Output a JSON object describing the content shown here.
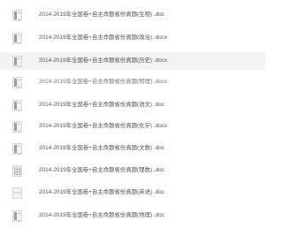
{
  "files": [
    {
      "name": "2014-2019年全国卷+自主命题省份真题(生物) .doc",
      "icon": "word-doc-icon",
      "selected": false
    },
    {
      "name": "2014-2019年全国卷+自主命题省份真题(政治) .docx",
      "icon": "word-doc-icon",
      "selected": false
    },
    {
      "name": "2014-2019年全国卷+自主命题省份真题(历史) .docx",
      "icon": "word-doc-icon",
      "selected": true
    },
    {
      "name": "2014-2019年全国卷+自主命题省份真题(物理) .docx",
      "icon": "word-doc-icon",
      "selected": false
    },
    {
      "name": "2014-2019年全国卷+自主命题省份真题(语文) .doc",
      "icon": "word-doc-icon",
      "selected": false
    },
    {
      "name": "2014-2019年全国卷+自主命题省份真题(化学) .docx",
      "icon": "word-doc-icon",
      "selected": false
    },
    {
      "name": "2014-2019年全国卷+自主命题省份真题(文数) .doc",
      "icon": "word-doc-icon",
      "selected": false
    },
    {
      "name": "2014-2019年全国卷+自主命题省份真题(理数) .doc",
      "icon": "spreadsheet-icon",
      "selected": false
    },
    {
      "name": "2014-2019年全国卷+自主命题省份真题(英语) .doc",
      "icon": "blank-file-icon",
      "selected": false
    },
    {
      "name": "2014-2019年全国卷+自主命题省份真题(地理) .doc",
      "icon": "word-doc-icon",
      "selected": false
    }
  ],
  "colors": {
    "selected_row": "#f3f3f3",
    "text": "#555555"
  }
}
